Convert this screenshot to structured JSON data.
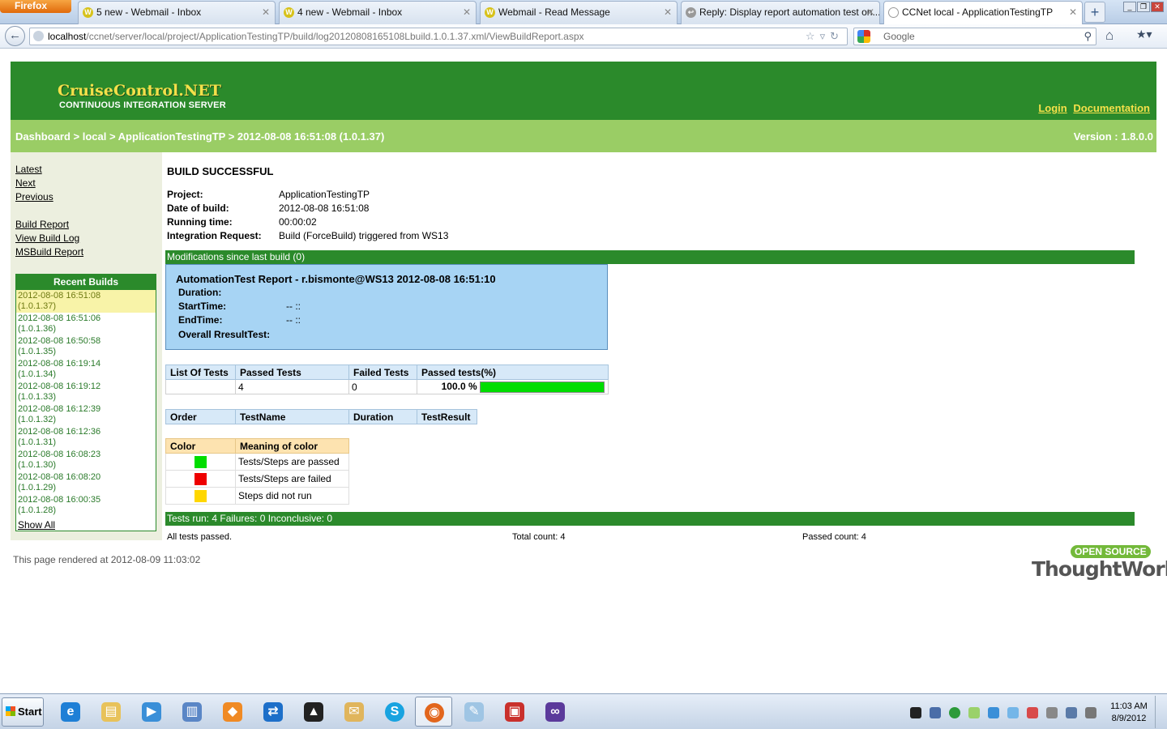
{
  "browser": {
    "menu_button": "Firefox",
    "tabs": [
      {
        "title": "5 new - Webmail - Inbox"
      },
      {
        "title": "4 new - Webmail - Inbox"
      },
      {
        "title": "Webmail - Read Message"
      },
      {
        "title": "Reply: Display report automation test on..."
      },
      {
        "title": "CCNet local - ApplicationTestingTP"
      }
    ],
    "new_tab": "+",
    "url_host": "localhost",
    "url_path": "/ccnet/server/local/project/ApplicationTestingTP/build/log20120808165108Lbuild.1.0.1.37.xml/ViewBuildReport.aspx",
    "search_placeholder": "Google"
  },
  "header": {
    "logo_title": "CruiseControl.NET",
    "logo_subtitle": "CONTINUOUS INTEGRATION SERVER",
    "login": "Login",
    "documentation": "Documentation"
  },
  "breadcrumb": {
    "path": "Dashboard > local > ApplicationTestingTP > 2012-08-08 16:51:08 (1.0.1.37)",
    "version": "Version : 1.8.0.0"
  },
  "sidebar": {
    "nav": [
      "Latest",
      "Next",
      "Previous"
    ],
    "reports": [
      "Build Report",
      "View Build Log",
      "MSBuild Report"
    ],
    "recent_heading": "Recent Builds",
    "builds": [
      {
        "date": "2012-08-08 16:51:08",
        "label": "(1.0.1.37)",
        "current": true
      },
      {
        "date": "2012-08-08 16:51:06",
        "label": "(1.0.1.36)"
      },
      {
        "date": "2012-08-08 16:50:58",
        "label": "(1.0.1.35)"
      },
      {
        "date": "2012-08-08 16:19:14",
        "label": "(1.0.1.34)"
      },
      {
        "date": "2012-08-08 16:19:12",
        "label": "(1.0.1.33)"
      },
      {
        "date": "2012-08-08 16:12:39",
        "label": "(1.0.1.32)"
      },
      {
        "date": "2012-08-08 16:12:36",
        "label": "(1.0.1.31)"
      },
      {
        "date": "2012-08-08 16:08:23",
        "label": "(1.0.1.30)"
      },
      {
        "date": "2012-08-08 16:08:20",
        "label": "(1.0.1.29)"
      },
      {
        "date": "2012-08-08 16:00:35",
        "label": "(1.0.1.28)"
      }
    ],
    "show_all": "Show All"
  },
  "build": {
    "status": "BUILD SUCCESSFUL",
    "labels": {
      "project": "Project:",
      "date": "Date of build:",
      "running": "Running time:",
      "request": "Integration Request:"
    },
    "project": "ApplicationTestingTP",
    "date": "2012-08-08 16:51:08",
    "running_time": "00:00:02",
    "integration_request": "Build (ForceBuild) triggered from WS13",
    "modifications": "Modifications since last build (0)"
  },
  "automation_report": {
    "title": "AutomationTest Report - r.bismonte@WS13 2012-08-08 16:51:10",
    "duration_label": "Duration:",
    "start_label": "StartTime:",
    "start_value": "-- ::",
    "end_label": "EndTime:",
    "end_value": "-- ::",
    "overall_label": "Overall RresultTest:"
  },
  "summary": {
    "headers": [
      "List Of Tests",
      "Passed Tests",
      "Failed Tests",
      "Passed tests(%)"
    ],
    "list_of_tests": "",
    "passed": "4",
    "failed": "0",
    "percent_text": "100.0 %",
    "percent_value": 100,
    "bar_color": "#00dd00"
  },
  "details": {
    "headers": [
      "Order",
      "TestName",
      "Duration",
      "TestResult"
    ]
  },
  "legend": {
    "headers": [
      "Color",
      "Meaning of color"
    ],
    "rows": [
      {
        "color": "#00dd00",
        "meaning": "Tests/Steps are passed"
      },
      {
        "color": "#ee0000",
        "meaning": "Tests/Steps are failed"
      },
      {
        "color": "#ffd700",
        "meaning": "Steps did not run"
      }
    ]
  },
  "results": {
    "bar": "Tests run: 4 Failures: 0 Inconclusive: 0",
    "all_passed": "All tests passed.",
    "total_count": "Total count: 4",
    "passed_count": "Passed count: 4"
  },
  "footer": {
    "rendered": "This page rendered at 2012-08-09 11:03:02",
    "badge": "OPEN SOURCE",
    "brand": "ThoughtWorks"
  },
  "taskbar": {
    "start": "Start",
    "apps": [
      "internet-explorer",
      "file-explorer",
      "media-player",
      "network-tool",
      "app-orange",
      "teamviewer",
      "app-hat",
      "mail-folder",
      "skype",
      "firefox",
      "notepad",
      "toolbox",
      "visual-studio"
    ],
    "time": "11:03 AM",
    "date": "8/9/2012"
  },
  "colors": {
    "header_green": "#2b8a2b",
    "breadcrumb_green": "#9acd65",
    "logo_yellow": "#f4e04a",
    "report_blue": "#a7d4f4"
  }
}
